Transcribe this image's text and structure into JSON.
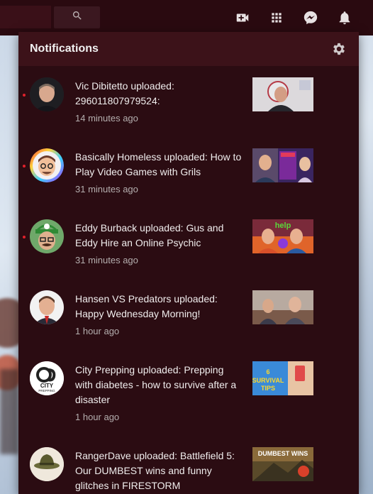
{
  "header": {
    "icons": [
      "search-icon",
      "create-video-icon",
      "apps-grid-icon",
      "messages-icon",
      "bell-icon"
    ]
  },
  "panel": {
    "title": "Notifications",
    "settings_icon": "gear-icon"
  },
  "notifications": [
    {
      "message": "Vic Dibitetto uploaded: 296011807979524:",
      "time": "14 minutes ago",
      "unread": true
    },
    {
      "message": "Basically Homeless uploaded: How to Play Video Games with Grils",
      "time": "31 minutes ago",
      "unread": true
    },
    {
      "message": "Eddy Burback uploaded: Gus and Eddy Hire an Online Psychic",
      "time": "31 minutes ago",
      "unread": true
    },
    {
      "message": "Hansen VS Predators uploaded: Happy Wednesday Morning!",
      "time": "1 hour ago",
      "unread": false
    },
    {
      "message": "City Prepping uploaded: Prepping with diabetes - how to survive after a disaster",
      "time": "1 hour ago",
      "unread": false
    },
    {
      "message": "RangerDave uploaded: Battlefield 5: Our DUMBEST wins and funny glitches in FIRESTORM",
      "time": "",
      "unread": false
    }
  ],
  "thumbnail_text": {
    "eddy": "help",
    "city_line1": "6",
    "city_line2": "SURVIVAL",
    "city_line3": "TIPS",
    "ranger": "DUMBEST WINS",
    "city_logo": "CITY",
    "city_logo_sub": "PREPPING"
  }
}
